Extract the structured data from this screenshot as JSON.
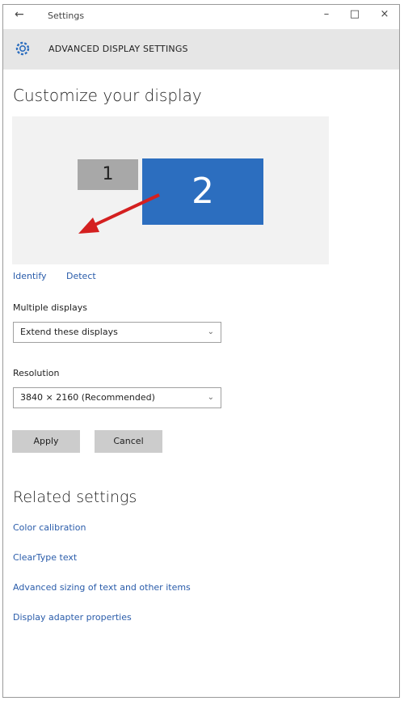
{
  "window": {
    "title": "Settings"
  },
  "titlebar": {
    "back": "←",
    "minimize": "–",
    "maximize": "□",
    "close": "×"
  },
  "header": {
    "title": "ADVANCED DISPLAY SETTINGS",
    "icon": "gear-icon"
  },
  "page": {
    "title": "Customize your display"
  },
  "preview": {
    "monitor1_label": "1",
    "monitor2_label": "2",
    "arrow_color": "#d42020",
    "monitor2_color": "#2c6ebf"
  },
  "links": {
    "identify": "Identify",
    "detect": "Detect"
  },
  "multiple_displays": {
    "label": "Multiple displays",
    "value": "Extend these displays"
  },
  "resolution": {
    "label": "Resolution",
    "value": "3840 × 2160 (Recommended)"
  },
  "buttons": {
    "apply": "Apply",
    "cancel": "Cancel"
  },
  "related": {
    "title": "Related settings",
    "items": [
      "Color calibration",
      "ClearType text",
      "Advanced sizing of text and other items",
      "Display adapter properties"
    ]
  }
}
